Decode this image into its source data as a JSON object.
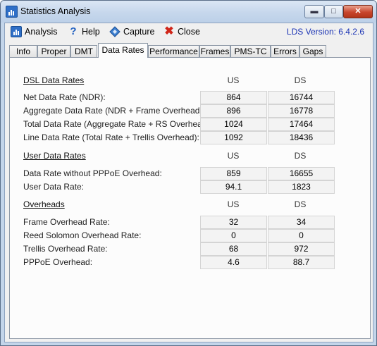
{
  "window": {
    "title": "Statistics Analysis"
  },
  "menu": {
    "analysis": "Analysis",
    "help": "Help",
    "capture": "Capture",
    "close": "Close",
    "version": "LDS Version: 6.4.2.6"
  },
  "tabs": [
    "Info",
    "Proper",
    "DMT",
    "Data Rates",
    "Performance",
    "Frames",
    "PMS-TC",
    "Errors",
    "Gaps"
  ],
  "active_tab": "Data Rates",
  "columns": {
    "us": "US",
    "ds": "DS"
  },
  "sections": {
    "dsl": {
      "title": "DSL Data Rates",
      "rows": [
        {
          "label": "Net Data Rate (NDR):",
          "us": "864",
          "ds": "16744"
        },
        {
          "label": "Aggregate Data Rate (NDR + Frame Overhead):",
          "us": "896",
          "ds": "16778"
        },
        {
          "label": "Total Data Rate (Aggregate Rate + RS Overhead):",
          "us": "1024",
          "ds": "17464"
        },
        {
          "label": "Line Data Rate (Total Rate + Trellis Overhead):",
          "us": "1092",
          "ds": "18436"
        }
      ]
    },
    "user": {
      "title": "User Data Rates",
      "rows": [
        {
          "label": "Data Rate without PPPoE Overhead:",
          "us": "859",
          "ds": "16655"
        },
        {
          "label": "User Data Rate:",
          "us": "94.1",
          "ds": "1823"
        }
      ]
    },
    "overheads": {
      "title": "Overheads",
      "rows": [
        {
          "label": "Frame Overhead Rate:",
          "us": "32",
          "ds": "34"
        },
        {
          "label": "Reed Solomon Overhead Rate:",
          "us": "0",
          "ds": "0"
        },
        {
          "label": "Trellis Overhead Rate:",
          "us": "68",
          "ds": "972"
        },
        {
          "label": "PPPoE Overhead:",
          "us": "4.6",
          "ds": "88.7"
        }
      ]
    }
  },
  "colors": {
    "title_bar": "#c6d7ec",
    "version_text": "#1a33b4",
    "close_button": "#c8452c"
  },
  "icons": {
    "app": "bar-chart-icon",
    "analysis": "bar-chart-icon",
    "help": "question-mark-icon",
    "capture": "diamond-capture-icon",
    "close": "red-x-icon"
  }
}
